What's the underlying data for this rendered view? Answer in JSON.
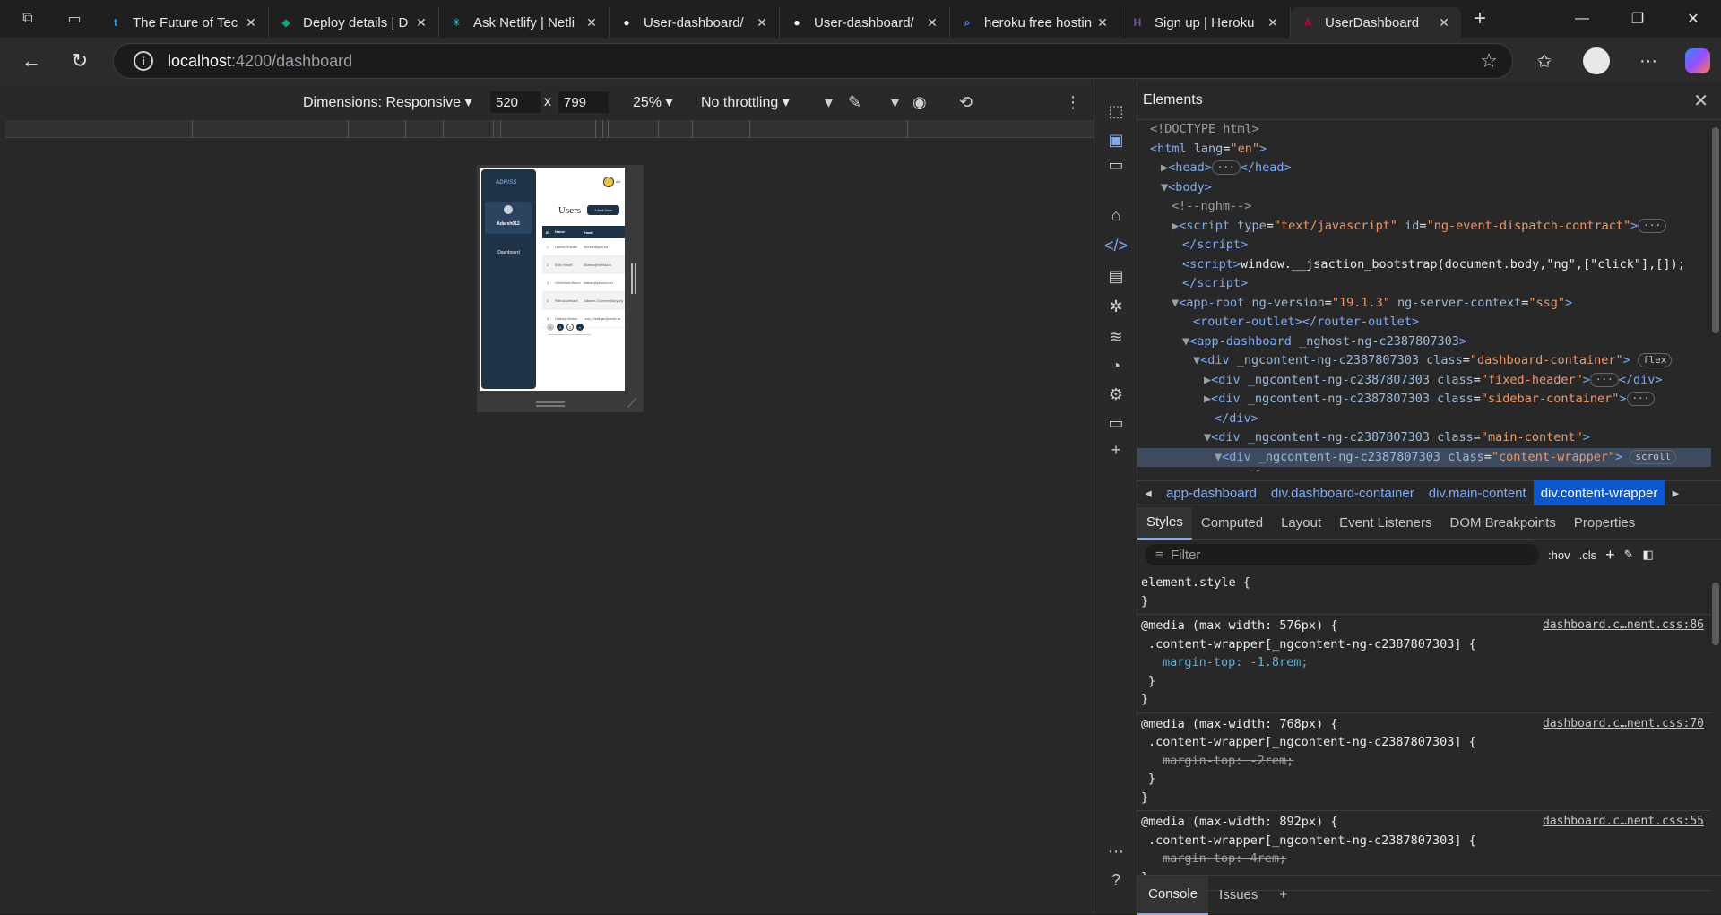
{
  "tabs": [
    {
      "title": "The Future of Tec",
      "fav_color": "#1da1f2",
      "fav_glyph": "t",
      "active": false
    },
    {
      "title": "Deploy details | D",
      "fav_color": "#14a387",
      "fav_glyph": "◆",
      "active": false
    },
    {
      "title": "Ask Netlify | Netli",
      "fav_color": "#32e6e2",
      "fav_glyph": "✳",
      "active": false
    },
    {
      "title": "User-dashboard/",
      "fav_color": "#ffffff",
      "fav_glyph": "●",
      "active": false
    },
    {
      "title": "User-dashboard/",
      "fav_color": "#ffffff",
      "fav_glyph": "●",
      "active": false
    },
    {
      "title": "heroku free hostin",
      "fav_color": "#4c8bf5",
      "fav_glyph": "⌕",
      "active": false
    },
    {
      "title": "Sign up | Heroku",
      "fav_color": "#79589f",
      "fav_glyph": "H",
      "active": false
    },
    {
      "title": "UserDashboard",
      "fav_color": "#c3002f",
      "fav_glyph": "A",
      "active": true
    }
  ],
  "address": {
    "host": "localhost",
    "path": ":4200/dashboard"
  },
  "device_bar": {
    "dimensions": "Dimensions: Responsive",
    "width": "520",
    "height": "799",
    "times": "x",
    "zoom": "25%",
    "throttling": "No throttling"
  },
  "preview": {
    "logo": "ADRISS",
    "username": "Adarsh012",
    "nav_dashboard": "Dashboard",
    "heading": "Users",
    "add_button": "+ Add User",
    "col_id": "ID",
    "col_name": "Name",
    "col_email": "Email",
    "rows": [
      {
        "id": "1",
        "name": "Leanne Graham",
        "email": "Sincere@april.biz"
      },
      {
        "id": "2",
        "name": "Ervin Howell",
        "email": "Shanna@melissa.tv"
      },
      {
        "id": "3",
        "name": "Clementine Bauch",
        "email": "Nathan@yesenia.net"
      },
      {
        "id": "4",
        "name": "Patricia Lebsack",
        "email": "Julianne.OConner@kory.org"
      },
      {
        "id": "5",
        "name": "Chelsey Dietrich",
        "email": "Lucio_Hettinger@annie.ca"
      }
    ],
    "pages": [
      "«",
      "1",
      "2",
      "»"
    ]
  },
  "devtools": {
    "panel_title": "Elements",
    "dom": [
      {
        "indent": 0,
        "html": "<span class='g'>&lt;!DOCTYPE html&gt;</span>"
      },
      {
        "indent": 0,
        "html": "<span class='t'>&lt;html</span> <span class='a'>lang</span>=<span class='v'>\"en\"</span><span class='t'>&gt;</span>"
      },
      {
        "indent": 1,
        "html": "<span class='g'>▶</span><span class='t'>&lt;head&gt;</span><span class='badge'>···</span><span class='t'>&lt;/head&gt;</span>"
      },
      {
        "indent": 1,
        "html": "<span class='g'>▼</span><span class='t'>&lt;body&gt;</span>"
      },
      {
        "indent": 2,
        "html": "<span class='g'>&lt;!--nghm--&gt;</span>"
      },
      {
        "indent": 2,
        "html": "<span class='g'>▶</span><span class='t'>&lt;script</span> <span class='a'>type</span>=<span class='v'>\"text/javascript\"</span> <span class='a'>id</span>=<span class='v'>\"ng-event-dispatch-contract\"</span><span class='t'>&gt;</span><span class='badge'>···</span>"
      },
      {
        "indent": 3,
        "html": "<span class='t'>&lt;/script&gt;</span>"
      },
      {
        "indent": 3,
        "html": "<span class='t'>&lt;script&gt;</span><span class='w'>window.__jsaction_bootstrap(document.body,\"ng\",[\"click\"],[]);</span>"
      },
      {
        "indent": 3,
        "html": "<span class='t'>&lt;/script&gt;</span>"
      },
      {
        "indent": 2,
        "html": "<span class='g'>▼</span><span class='t'>&lt;app-root</span> <span class='a'>ng-version</span>=<span class='v'>\"19.1.3\"</span> <span class='a'>ng-server-context</span>=<span class='v'>\"ssg\"</span><span class='t'>&gt;</span>"
      },
      {
        "indent": 4,
        "html": "<span class='t'>&lt;router-outlet&gt;&lt;/router-outlet&gt;</span>"
      },
      {
        "indent": 3,
        "html": "<span class='g'>▼</span><span class='t'>&lt;app-dashboard</span> <span class='a'>_nghost-ng-c2387807303</span><span class='t'>&gt;</span>"
      },
      {
        "indent": 4,
        "html": "<span class='g'>▼</span><span class='t'>&lt;div</span> <span class='a'>_ngcontent-ng-c2387807303</span> <span class='a'>class</span>=<span class='v'>\"dashboard-container\"</span><span class='t'>&gt;</span> <span class='badge'>flex</span>"
      },
      {
        "indent": 5,
        "html": "<span class='g'>▶</span><span class='t'>&lt;div</span> <span class='a'>_ngcontent-ng-c2387807303</span> <span class='a'>class</span>=<span class='v'>\"fixed-header\"</span><span class='t'>&gt;</span><span class='badge'>···</span><span class='t'>&lt;/div&gt;</span>"
      },
      {
        "indent": 5,
        "html": "<span class='g'>▶</span><span class='t'>&lt;div</span> <span class='a'>_ngcontent-ng-c2387807303</span> <span class='a'>class</span>=<span class='v'>\"sidebar-container\"</span><span class='t'>&gt;</span><span class='badge'>···</span>"
      },
      {
        "indent": 6,
        "html": "<span class='t'>&lt;/div&gt;</span>"
      },
      {
        "indent": 5,
        "html": "<span class='g'>▼</span><span class='t'>&lt;div</span> <span class='a'>_ngcontent-ng-c2387807303</span> <span class='a'>class</span>=<span class='v'>\"main-content\"</span><span class='t'>&gt;</span>"
      },
      {
        "indent": 6,
        "html": "<span class='g'>▼</span><span class='t'>&lt;div</span> <span class='a'>_ngcontent-ng-c2387807303</span> <span class='a'>class</span>=<span class='v'>\"content-wrapper\"</span><span class='t'>&gt;</span> <span class='badge'>scroll</span>",
        "selected": true
      },
      {
        "indent": 7,
        "html": "<span class='g'>== $0</span>"
      }
    ],
    "breadcrumbs": [
      "app-dashboard",
      "div.dashboard-container",
      "div.main-content",
      "div.content-wrapper"
    ],
    "style_tabs": [
      "Styles",
      "Computed",
      "Layout",
      "Event Listeners",
      "DOM Breakpoints",
      "Properties"
    ],
    "filter_placeholder": "Filter",
    "hov": ":hov",
    "cls": ".cls",
    "rules": [
      {
        "lines": [
          "element.style {",
          "}"
        ],
        "src": ""
      },
      {
        "lines": [
          "@media (max-width: 576px) {",
          ".content-wrapper[_ngcontent-ng-c2387807303] {",
          "margin-top: -1.8rem;",
          "}",
          "}"
        ],
        "src": "dashboard.c…nent.css:86",
        "strike": false
      },
      {
        "lines": [
          "@media (max-width: 768px) {",
          ".content-wrapper[_ngcontent-ng-c2387807303] {",
          "margin-top: -2rem;",
          "}",
          "}"
        ],
        "src": "dashboard.c…nent.css:70",
        "strike": true
      },
      {
        "lines": [
          "@media (max-width: 892px) {",
          ".content-wrapper[_ngcontent-ng-c2387807303] {",
          "margin-top: 4rem;",
          "}"
        ],
        "src": "dashboard.c…nent.css:55",
        "strike": true
      }
    ],
    "drawer_tabs": [
      "Console",
      "Issues"
    ]
  }
}
